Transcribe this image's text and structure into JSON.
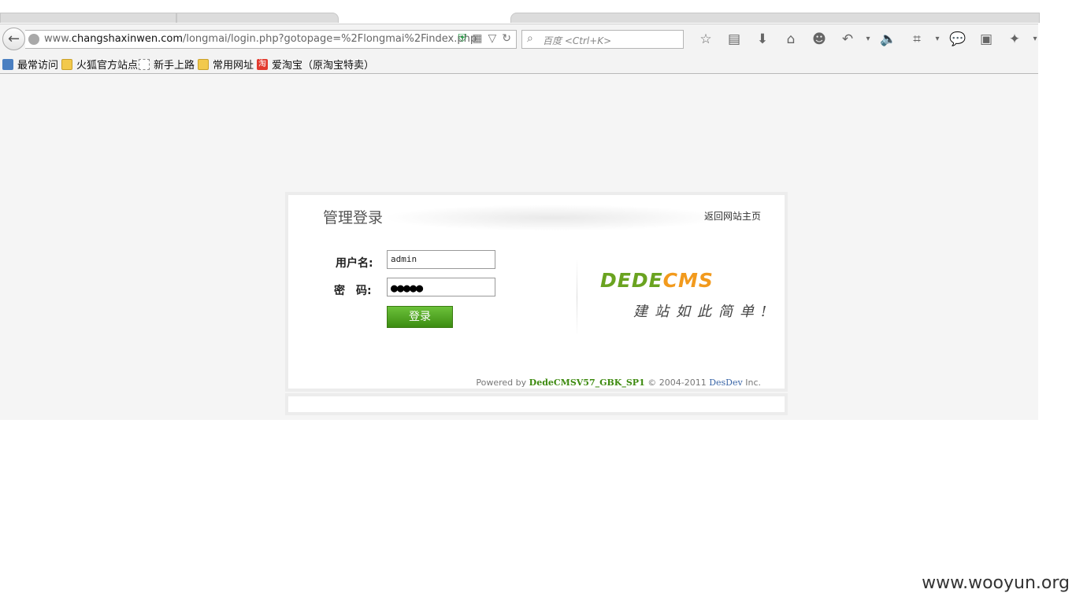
{
  "browser": {
    "url_prefix": "www.",
    "url_domain": "changshaxinwen.com",
    "url_path": "/longmai/login.php?gotopage=%2Flongmai%2Findex.php",
    "search_placeholder": "百度 <Ctrl+K>",
    "toolbar_icons": [
      "star-icon",
      "reader-icon",
      "download-icon",
      "home-icon",
      "smiley-icon",
      "undo-icon",
      "volume-icon",
      "crop-icon",
      "chat-icon",
      "translate-icon",
      "extension-icon"
    ]
  },
  "bookmarks": [
    {
      "label": "最常访问",
      "icon": "most-visited-icon"
    },
    {
      "label": "火狐官方站点",
      "icon": "folder-icon"
    },
    {
      "label": "新手上路",
      "icon": "page-icon"
    },
    {
      "label": "常用网址",
      "icon": "folder-icon"
    },
    {
      "label": "爱淘宝（原淘宝特卖）",
      "icon": "taobao-icon",
      "icon_text": "淘"
    }
  ],
  "login": {
    "title": "管理登录",
    "back_home": "返回网站主页",
    "username_label": "用户名:",
    "password_label": "密　码:",
    "username_value": "admin",
    "password_mask": "●●●●●",
    "submit_label": "登录",
    "brand_green": "DEDE",
    "brand_orange": "CMS",
    "slogan": "建站如此简单!",
    "powered_prefix": "Powered by",
    "powered_version": "DedeCMSV57_GBK_SP1",
    "powered_copy": "© 2004-2011",
    "powered_dev": "DesDev",
    "powered_suffix": "Inc."
  },
  "watermark": "www.wooyun.org",
  "colors": {
    "brand_green": "#6aa320",
    "brand_orange": "#f29a1d",
    "button_green": "#4fa21f"
  }
}
